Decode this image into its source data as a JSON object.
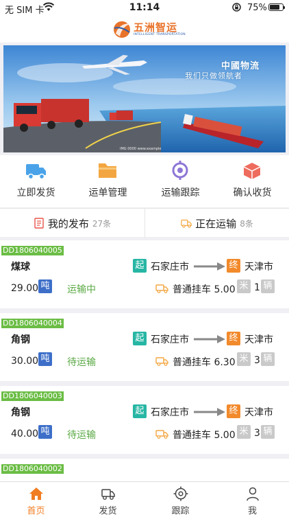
{
  "status_bar": {
    "carrier": "无 SIM 卡",
    "time": "11:14",
    "battery": "75%",
    "battery_level": 0.75
  },
  "logo": {
    "name": "五洲智运",
    "subtitle": "INTELLIGENT TRANSPORTATION"
  },
  "banner": {
    "title": "中國物流",
    "subtitle": "我们只做领航者"
  },
  "quick_actions": [
    {
      "label": "立即发货",
      "icon": "truck-icon",
      "color": "#4aa3e8"
    },
    {
      "label": "运单管理",
      "icon": "folder-icon",
      "color": "#f3a640"
    },
    {
      "label": "运输跟踪",
      "icon": "location-icon",
      "color": "#8d76d6"
    },
    {
      "label": "确认收货",
      "icon": "package-icon",
      "color": "#ee6c5d"
    }
  ],
  "tabs": [
    {
      "label": "我的发布",
      "count": "27条",
      "icon": "document-icon"
    },
    {
      "label": "正在运输",
      "count": "8条",
      "icon": "truck-icon"
    }
  ],
  "orders": [
    {
      "id": "DD1806040005",
      "goods": "煤球",
      "weight": "29.00",
      "unit": "吨",
      "status": "运输中",
      "origin_tag": "起",
      "from": "石家庄市",
      "dest_tag": "终",
      "to": "天津市",
      "vehicle": "普通挂车 5.00",
      "length_unit": "米",
      "quantity": "1",
      "quantity_unit": "辆"
    },
    {
      "id": "DD1806040004",
      "goods": "角钢",
      "weight": "30.00",
      "unit": "吨",
      "status": "待运输",
      "origin_tag": "起",
      "from": "石家庄市",
      "dest_tag": "终",
      "to": "天津市",
      "vehicle": "普通挂车 6.30",
      "length_unit": "米",
      "quantity": "3",
      "quantity_unit": "辆"
    },
    {
      "id": "DD1806040003",
      "goods": "角钢",
      "weight": "40.00",
      "unit": "吨",
      "status": "待运输",
      "origin_tag": "起",
      "from": "石家庄市",
      "dest_tag": "终",
      "to": "天津市",
      "vehicle": "普通挂车 5.00",
      "length_unit": "米",
      "quantity": "3",
      "quantity_unit": "辆"
    },
    {
      "id": "DD1806040002"
    }
  ],
  "tab_bar": [
    {
      "label": "首页",
      "icon": "home-icon",
      "active": true
    },
    {
      "label": "发货",
      "icon": "truck-icon",
      "active": false
    },
    {
      "label": "跟踪",
      "icon": "target-icon",
      "active": false
    },
    {
      "label": "我",
      "icon": "user-icon",
      "active": false
    }
  ],
  "colors": {
    "accent": "#f07d22",
    "id_badge": "#6bbd45",
    "unit_badge": "#3d6fc9",
    "origin_badge": "#27b6a4",
    "dest_badge": "#f28a2c",
    "status_text": "#5aa944"
  }
}
